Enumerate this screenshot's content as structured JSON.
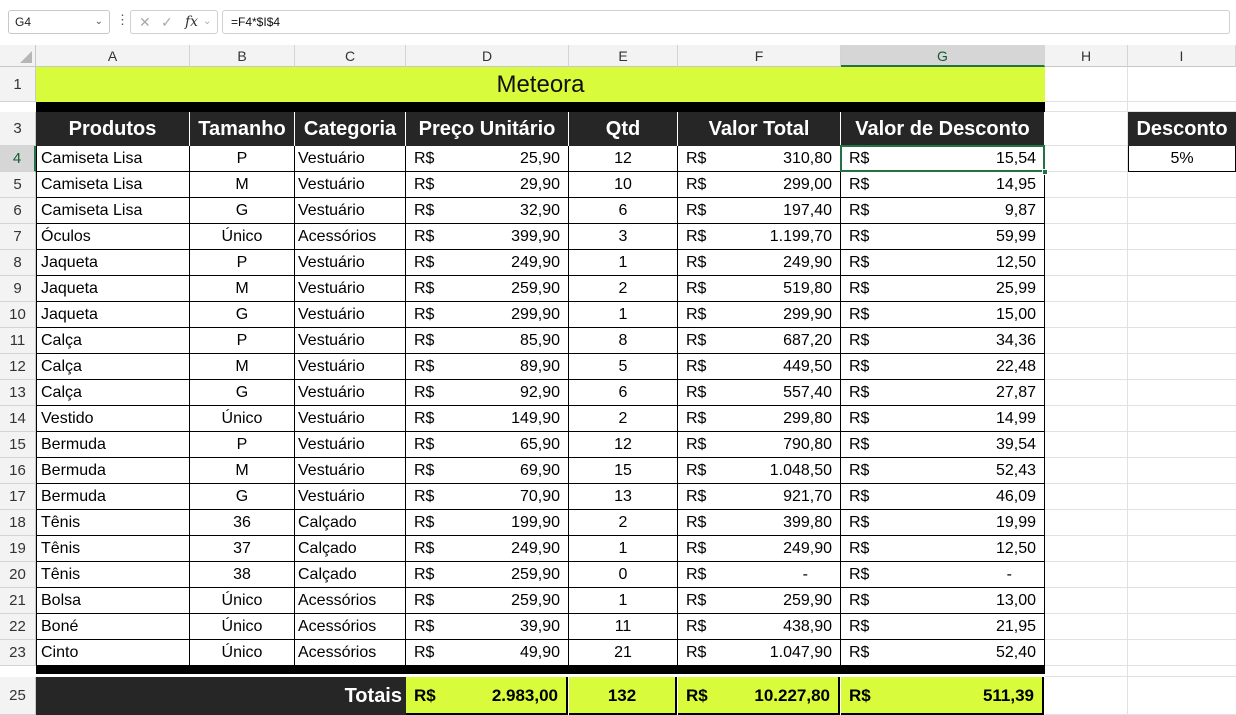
{
  "formula_bar": {
    "name_box": "G4",
    "formula": "=F4*$I$4"
  },
  "columns": [
    "A",
    "B",
    "C",
    "D",
    "E",
    "F",
    "G",
    "H",
    "I"
  ],
  "row_numbers": [
    "1",
    "3",
    "4",
    "5",
    "6",
    "7",
    "8",
    "9",
    "10",
    "11",
    "12",
    "13",
    "14",
    "15",
    "16",
    "17",
    "18",
    "19",
    "20",
    "21",
    "22",
    "23",
    "25"
  ],
  "title": "Meteora",
  "headers": {
    "produtos": "Produtos",
    "tamanho": "Tamanho",
    "categoria": "Categoria",
    "preco": "Preço Unitário",
    "qtd": "Qtd",
    "valor_total": "Valor Total",
    "valor_desconto": "Valor de Desconto",
    "desconto": "Desconto"
  },
  "desconto_value": "5%",
  "currency": "R$",
  "rows": [
    {
      "produto": "Camiseta Lisa",
      "tamanho": "P",
      "categoria": "Vestuário",
      "preco": "25,90",
      "qtd": "12",
      "total": "310,80",
      "desconto": "15,54"
    },
    {
      "produto": "Camiseta Lisa",
      "tamanho": "M",
      "categoria": "Vestuário",
      "preco": "29,90",
      "qtd": "10",
      "total": "299,00",
      "desconto": "14,95"
    },
    {
      "produto": "Camiseta Lisa",
      "tamanho": "G",
      "categoria": "Vestuário",
      "preco": "32,90",
      "qtd": "6",
      "total": "197,40",
      "desconto": "9,87"
    },
    {
      "produto": "Óculos",
      "tamanho": "Único",
      "categoria": "Acessórios",
      "preco": "399,90",
      "qtd": "3",
      "total": "1.199,70",
      "desconto": "59,99"
    },
    {
      "produto": "Jaqueta",
      "tamanho": "P",
      "categoria": "Vestuário",
      "preco": "249,90",
      "qtd": "1",
      "total": "249,90",
      "desconto": "12,50"
    },
    {
      "produto": "Jaqueta",
      "tamanho": "M",
      "categoria": "Vestuário",
      "preco": "259,90",
      "qtd": "2",
      "total": "519,80",
      "desconto": "25,99"
    },
    {
      "produto": "Jaqueta",
      "tamanho": "G",
      "categoria": "Vestuário",
      "preco": "299,90",
      "qtd": "1",
      "total": "299,90",
      "desconto": "15,00"
    },
    {
      "produto": "Calça",
      "tamanho": "P",
      "categoria": "Vestuário",
      "preco": "85,90",
      "qtd": "8",
      "total": "687,20",
      "desconto": "34,36"
    },
    {
      "produto": "Calça",
      "tamanho": "M",
      "categoria": "Vestuário",
      "preco": "89,90",
      "qtd": "5",
      "total": "449,50",
      "desconto": "22,48"
    },
    {
      "produto": "Calça",
      "tamanho": "G",
      "categoria": "Vestuário",
      "preco": "92,90",
      "qtd": "6",
      "total": "557,40",
      "desconto": "27,87"
    },
    {
      "produto": "Vestido",
      "tamanho": "Único",
      "categoria": "Vestuário",
      "preco": "149,90",
      "qtd": "2",
      "total": "299,80",
      "desconto": "14,99"
    },
    {
      "produto": "Bermuda",
      "tamanho": "P",
      "categoria": "Vestuário",
      "preco": "65,90",
      "qtd": "12",
      "total": "790,80",
      "desconto": "39,54"
    },
    {
      "produto": "Bermuda",
      "tamanho": "M",
      "categoria": "Vestuário",
      "preco": "69,90",
      "qtd": "15",
      "total": "1.048,50",
      "desconto": "52,43"
    },
    {
      "produto": "Bermuda",
      "tamanho": "G",
      "categoria": "Vestuário",
      "preco": "70,90",
      "qtd": "13",
      "total": "921,70",
      "desconto": "46,09"
    },
    {
      "produto": "Tênis",
      "tamanho": "36",
      "categoria": "Calçado",
      "preco": "199,90",
      "qtd": "2",
      "total": "399,80",
      "desconto": "19,99"
    },
    {
      "produto": "Tênis",
      "tamanho": "37",
      "categoria": "Calçado",
      "preco": "249,90",
      "qtd": "1",
      "total": "249,90",
      "desconto": "12,50"
    },
    {
      "produto": "Tênis",
      "tamanho": "38",
      "categoria": "Calçado",
      "preco": "259,90",
      "qtd": "0",
      "total": "-",
      "desconto": "-"
    },
    {
      "produto": "Bolsa",
      "tamanho": "Único",
      "categoria": "Acessórios",
      "preco": "259,90",
      "qtd": "1",
      "total": "259,90",
      "desconto": "13,00"
    },
    {
      "produto": "Boné",
      "tamanho": "Único",
      "categoria": "Acessórios",
      "preco": "39,90",
      "qtd": "11",
      "total": "438,90",
      "desconto": "21,95"
    },
    {
      "produto": "Cinto",
      "tamanho": "Único",
      "categoria": "Acessórios",
      "preco": "49,90",
      "qtd": "21",
      "total": "1.047,90",
      "desconto": "52,40"
    }
  ],
  "totals": {
    "label": "Totais",
    "preco": "2.983,00",
    "qtd": "132",
    "total": "10.227,80",
    "desconto": "511,39"
  },
  "colors": {
    "accent": "#d8fb3c",
    "header_bg": "#262626",
    "selection": "#217346"
  }
}
